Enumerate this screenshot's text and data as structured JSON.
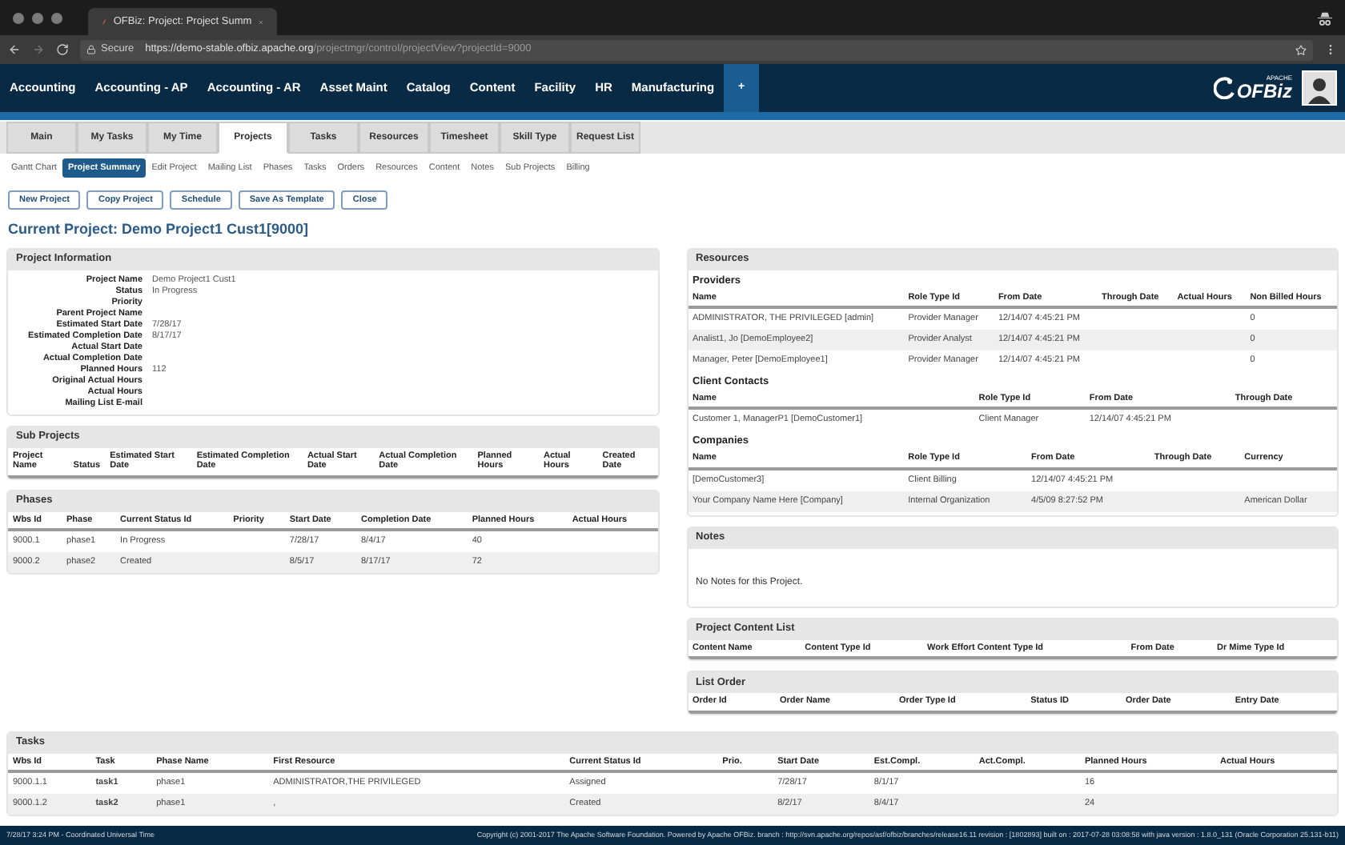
{
  "browser": {
    "tab_title": "OFBiz: Project: Project Summ",
    "security": "Secure",
    "url_host": "https://demo-stable.ofbiz.apache.org",
    "url_path": "/projectmgr/control/projectView?projectId=9000"
  },
  "top_nav": {
    "items": [
      "Accounting",
      "Accounting - AP",
      "Accounting - AR",
      "Asset Maint",
      "Catalog",
      "Content",
      "Facility",
      "HR",
      "Manufacturing"
    ],
    "more": "+",
    "logo_small": "APACHE",
    "logo": "OFBiz"
  },
  "tabs": [
    {
      "label": "Main",
      "selected": false
    },
    {
      "label": "My Tasks",
      "selected": false
    },
    {
      "label": "My Time",
      "selected": false
    },
    {
      "label": "Projects",
      "selected": true
    },
    {
      "label": "Tasks",
      "selected": false
    },
    {
      "label": "Resources",
      "selected": false
    },
    {
      "label": "Timesheet",
      "selected": false
    },
    {
      "label": "Skill Type",
      "selected": false
    },
    {
      "label": "Request List",
      "selected": false
    }
  ],
  "sub_nav": [
    {
      "label": "Gantt Chart",
      "selected": false
    },
    {
      "label": "Project Summary",
      "selected": true
    },
    {
      "label": "Edit Project",
      "selected": false
    },
    {
      "label": "Mailing List",
      "selected": false
    },
    {
      "label": "Phases",
      "selected": false
    },
    {
      "label": "Tasks",
      "selected": false
    },
    {
      "label": "Orders",
      "selected": false
    },
    {
      "label": "Resources",
      "selected": false
    },
    {
      "label": "Content",
      "selected": false
    },
    {
      "label": "Notes",
      "selected": false
    },
    {
      "label": "Sub Projects",
      "selected": false
    },
    {
      "label": "Billing",
      "selected": false
    }
  ],
  "buttons": [
    "New Project",
    "Copy Project",
    "Schedule",
    "Save As Template",
    "Close"
  ],
  "page_title": "Current Project: Demo Project1 Cust1[9000]",
  "left": [
    {
      "kind": "fields",
      "title": "Project Information",
      "fields": [
        {
          "label": "Project Name",
          "value": "Demo Project1 Cust1"
        },
        {
          "label": "Status",
          "value": "In Progress"
        },
        {
          "label": "Priority"
        },
        {
          "label": "Parent Project Name"
        },
        {
          "label": "Estimated Start Date",
          "value": "7/28/17"
        },
        {
          "label": "Estimated Completion Date",
          "value": "8/17/17"
        },
        {
          "label": "Actual Start Date"
        },
        {
          "label": "Actual Completion Date"
        },
        {
          "label": "Planned Hours",
          "value": "112"
        },
        {
          "label": "Original Actual Hours"
        },
        {
          "label": "Actual Hours"
        },
        {
          "label": "Mailing List E-mail"
        }
      ]
    },
    {
      "kind": "table",
      "title": "Sub Projects",
      "columns": [
        "Project Name",
        "Status",
        "Estimated Start Date",
        "Estimated Completion Date",
        "Actual Start Date",
        "Actual Completion Date",
        "Planned Hours",
        "Actual Hours",
        "Created Date"
      ]
    },
    {
      "kind": "table",
      "title": "Phases",
      "columns": [
        "Wbs Id",
        "Phase",
        "Current Status Id",
        "Priority",
        "Start Date",
        "Completion Date",
        "Planned Hours",
        "Actual Hours"
      ],
      "rows": [
        [
          "9000.1",
          "phase1",
          "In Progress",
          null,
          "7/28/17",
          "8/4/17",
          "40",
          null
        ],
        [
          "9000.2",
          "phase2",
          "Created",
          null,
          "8/5/17",
          "8/17/17",
          "72",
          null
        ]
      ]
    }
  ],
  "right": [
    {
      "kind": "groups",
      "title": "Resources",
      "groups": [
        {
          "title": "Providers",
          "columns": [
            "Name",
            "Role Type Id",
            "From Date",
            "Through Date",
            "Actual Hours",
            "Non Billed Hours"
          ],
          "rows": [
            [
              "ADMINISTRATOR, THE PRIVILEGED [admin]",
              "Provider Manager",
              "12/14/07 4:45:21 PM",
              null,
              null,
              "0"
            ],
            [
              "Analist1, Jo [DemoEmployee2]",
              "Provider Analyst",
              "12/14/07 4:45:21 PM",
              null,
              null,
              "0"
            ],
            [
              "Manager, Peter [DemoEmployee1]",
              "Provider Manager",
              "12/14/07 4:45:21 PM",
              null,
              null,
              "0"
            ]
          ]
        },
        {
          "title": "Client Contacts",
          "columns": [
            "Name",
            "Role Type Id",
            "From Date",
            "Through Date"
          ],
          "rows": [
            [
              "Customer 1, ManagerP1 [DemoCustomer1]",
              "Client Manager",
              "12/14/07 4:45:21 PM",
              null
            ]
          ]
        },
        {
          "title": "Companies",
          "columns": [
            "Name",
            "Role Type Id",
            "From Date",
            "Through Date",
            "Currency"
          ],
          "rows": [
            [
              "[DemoCustomer3]",
              "Client Billing",
              "12/14/07 4:45:21 PM",
              null,
              null
            ],
            [
              "Your Company Name Here [Company]",
              "Internal Organization",
              "4/5/09 8:27:52 PM",
              null,
              "American Dollar"
            ]
          ]
        }
      ]
    },
    {
      "kind": "text",
      "title": "Notes",
      "text": "No Notes for this Project."
    },
    {
      "kind": "table",
      "title": "Project Content List",
      "columns": [
        "Content Name",
        "Content Type Id",
        "Work Effort Content Type Id",
        "From Date",
        "Dr Mime Type Id"
      ]
    },
    {
      "kind": "table",
      "title": "List Order",
      "columns": [
        "Order Id",
        "Order Name",
        "Order Type Id",
        "Status ID",
        "Order Date",
        "Entry Date"
      ]
    }
  ],
  "tasks": {
    "kind": "table",
    "title": "Tasks",
    "columns": [
      "Wbs Id",
      "Task",
      "Phase Name",
      "First Resource",
      "Current Status Id",
      "Prio.",
      "Start Date",
      "Est.Compl.",
      "Act.Compl.",
      "Planned Hours",
      "Actual Hours"
    ],
    "rows": [
      [
        "9000.1.1",
        "task1",
        "phase1",
        "ADMINISTRATOR,THE PRIVILEGED",
        "Assigned",
        null,
        "7/28/17",
        "8/1/17",
        null,
        "16",
        null
      ],
      [
        "9000.1.2",
        "task2",
        "phase1",
        ",",
        "Created",
        null,
        "8/2/17",
        "8/4/17",
        null,
        "24",
        null
      ]
    ]
  },
  "footer": {
    "left": "7/28/17 3:24 PM - Coordinated Universal Time",
    "right": "Copyright (c) 2001-2017 The Apache Software Foundation. Powered by Apache OFBiz. branch : http://svn.apache.org/repos/asf/ofbiz/branches/release16.11 revision : [1802893] built on : 2017-07-28 03:08:58 with java version : 1.8.0_131 (Oracle Corporation 25.131-b11)"
  }
}
